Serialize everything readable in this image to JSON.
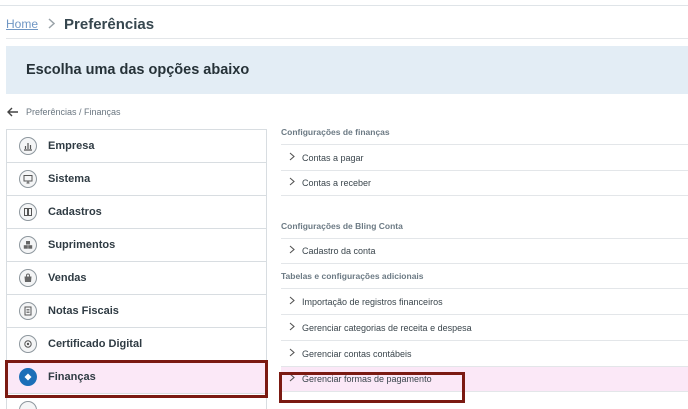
{
  "breadcrumb": {
    "home": "Home",
    "current": "Preferências"
  },
  "banner": {
    "text": "Escolha uma das opções abaixo"
  },
  "subnav": {
    "path": "Preferências / Finanças"
  },
  "menu": {
    "items": [
      {
        "label": "Empresa",
        "icon": "chart-icon"
      },
      {
        "label": "Sistema",
        "icon": "monitor-icon"
      },
      {
        "label": "Cadastros",
        "icon": "book-icon"
      },
      {
        "label": "Suprimentos",
        "icon": "boxes-icon"
      },
      {
        "label": "Vendas",
        "icon": "bag-icon"
      },
      {
        "label": "Notas Fiscais",
        "icon": "document-icon"
      },
      {
        "label": "Certificado Digital",
        "icon": "certificate-icon"
      },
      {
        "label": "Finanças",
        "icon": "finance-icon"
      }
    ]
  },
  "panel": {
    "sections": [
      {
        "title": "Configurações de finanças",
        "links": [
          "Contas a pagar",
          "Contas a receber"
        ]
      },
      {
        "title": "Configurações de Bling Conta",
        "links": [
          "Cadastro da conta"
        ]
      },
      {
        "title": "Tabelas e configurações adicionais",
        "links": [
          "Importação de registros financeiros",
          "Gerenciar categorias de receita e despesa",
          "Gerenciar contas contábeis",
          "Gerenciar formas de pagamento"
        ]
      }
    ]
  },
  "colors": {
    "highlight_border": "#7b1a12",
    "highlight_fill": "#fbe8f7",
    "banner_bg": "#e3edf5",
    "accent": "#1b6fb8"
  }
}
